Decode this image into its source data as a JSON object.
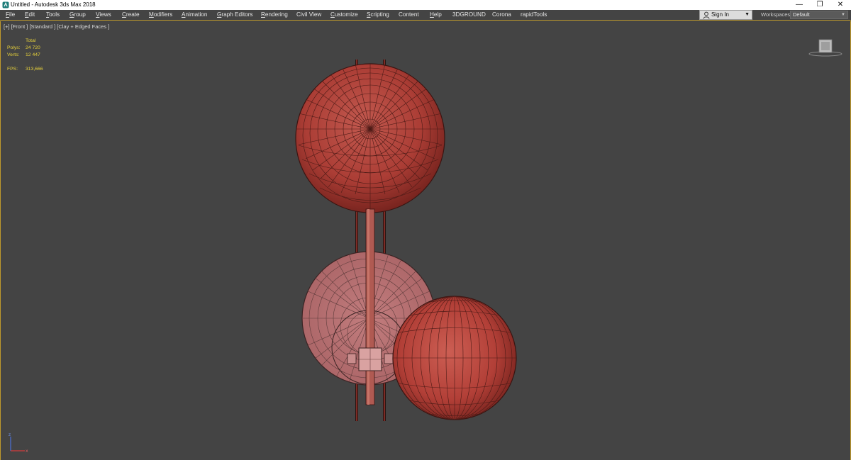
{
  "window": {
    "title": "Untitled - Autodesk 3ds Max 2018",
    "controls": {
      "minimize": "—",
      "restore": "❐",
      "close": "✕"
    }
  },
  "menu": [
    {
      "label": "File",
      "u": "F"
    },
    {
      "label": "Edit",
      "u": "E"
    },
    {
      "label": "Tools",
      "u": "T"
    },
    {
      "label": "Group",
      "u": "G"
    },
    {
      "label": "Views",
      "u": "V"
    },
    {
      "label": "Create",
      "u": "C"
    },
    {
      "label": "Modifiers",
      "u": "M"
    },
    {
      "label": "Animation",
      "u": "A"
    },
    {
      "label": "Graph Editors",
      "u": "G"
    },
    {
      "label": "Rendering",
      "u": "R"
    },
    {
      "label": "Civil View",
      "u": ""
    },
    {
      "label": "Customize",
      "u": "C"
    },
    {
      "label": "Scripting",
      "u": "S"
    },
    {
      "label": "Content",
      "u": ""
    },
    {
      "label": "Help",
      "u": "H"
    },
    {
      "label": "3DGROUND",
      "u": ""
    },
    {
      "label": "Corona",
      "u": ""
    },
    {
      "label": "rapidTools",
      "u": ""
    }
  ],
  "account": {
    "sign_in": "Sign In",
    "caret": "▼"
  },
  "workspaces": {
    "label": "Workspaces:",
    "value": "Default",
    "caret": "▼"
  },
  "viewport": {
    "label": "[+] [Front ] [Standard ] [Clay + Edged Faces ]",
    "stats": {
      "header": "Total",
      "polys_label": "Polys:",
      "polys_value": "24 720",
      "verts_label": "Verts:",
      "verts_value": "12 447",
      "fps_label": "FPS:",
      "fps_value": "313,666"
    }
  },
  "colors": {
    "accent": "#bf9a2c",
    "viewport_bg": "#444444",
    "stats_text": "#e8d23a",
    "sphere_red": "#b4413a",
    "disk_pink": "#b87173"
  },
  "icons": {
    "app": "3dsmax-logo-icon",
    "user": "user-icon",
    "navcube": "viewcube-icon",
    "axis": "axis-tripod-icon"
  }
}
